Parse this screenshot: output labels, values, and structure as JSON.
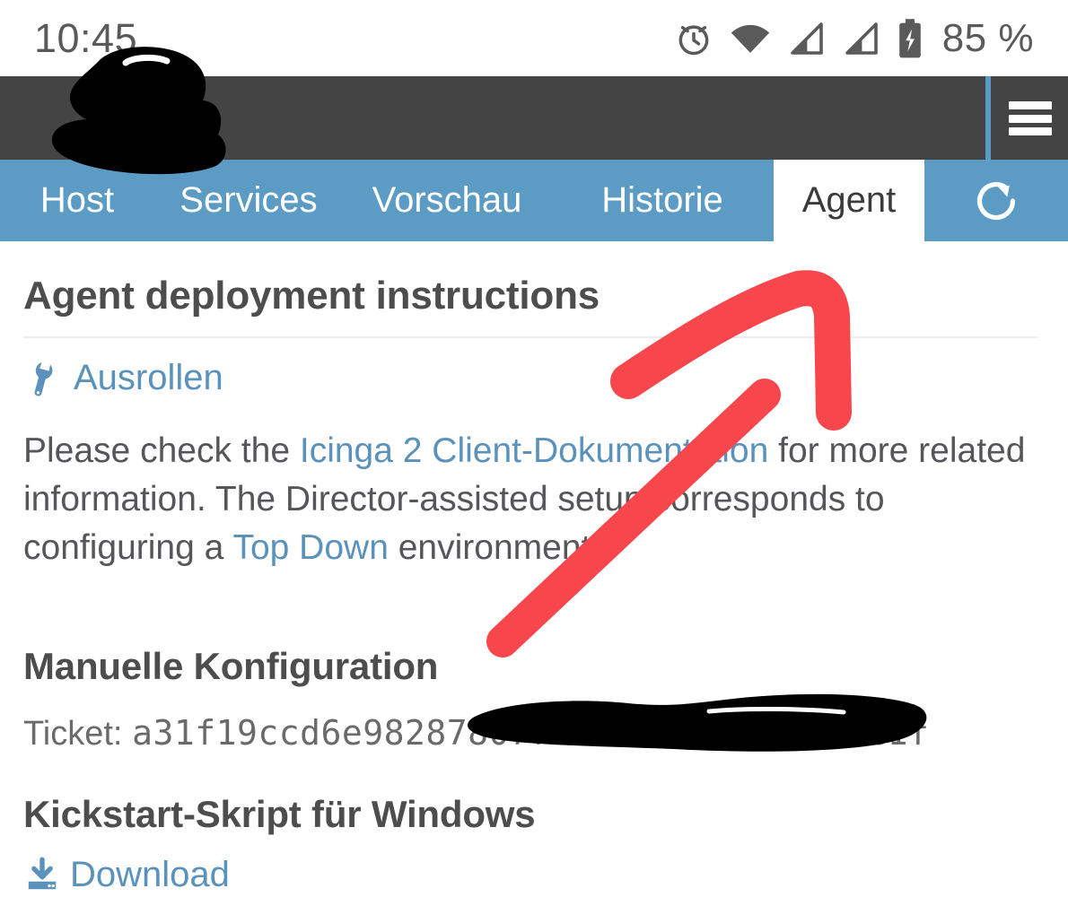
{
  "statusbar": {
    "clock": "10:45",
    "battery_percent": "85 %",
    "icons": [
      "alarm-icon",
      "wifi-icon",
      "signal-sim1-icon",
      "signal-sim2-icon",
      "battery-charging-icon"
    ]
  },
  "appbar": {
    "menu_icon": "hamburger-menu-icon",
    "logo_redacted": true,
    "background_color": "#444444",
    "divider_color": "#5b9bc4"
  },
  "tabs": {
    "accent_color": "#5b9bc4",
    "items": [
      {
        "label": "Host",
        "active": false
      },
      {
        "label": "Services",
        "active": false
      },
      {
        "label": "Vorschau",
        "active": false
      },
      {
        "label": "Historie",
        "active": false
      },
      {
        "label": "Agent",
        "active": true
      }
    ],
    "refresh_icon": "refresh-icon"
  },
  "main": {
    "heading": "Agent deployment instructions",
    "deploy_link": {
      "icon": "wrench-icon",
      "label": "Ausrollen"
    },
    "paragraph": {
      "part1": "Please check the ",
      "link1": "Icinga 2 Client-Dokumentation",
      "part2": " for more related information. The Director-assisted setup corresponds to configuring a ",
      "link2": "Top Down",
      "part3": " environment."
    },
    "manual_config": {
      "heading": "Manuelle Konfiguration",
      "ticket_label": "Ticket: ",
      "ticket_value": "a31f19ccd6e98287807707463b2d5e1f9a4c1f",
      "ticket_redacted": true
    },
    "kickstart": {
      "heading": "Kickstart-Skript für Windows",
      "download_link": {
        "icon": "download-icon",
        "label": "Download"
      }
    }
  },
  "annotations": {
    "arrow_color": "#f7474c",
    "redaction_color": "#000000",
    "arrow_name": "red-arrow-annotation"
  },
  "colors": {
    "link": "#5a92bb",
    "heading": "#4d4d4d",
    "body_text": "#55555a",
    "page_background": "#ffffff"
  }
}
